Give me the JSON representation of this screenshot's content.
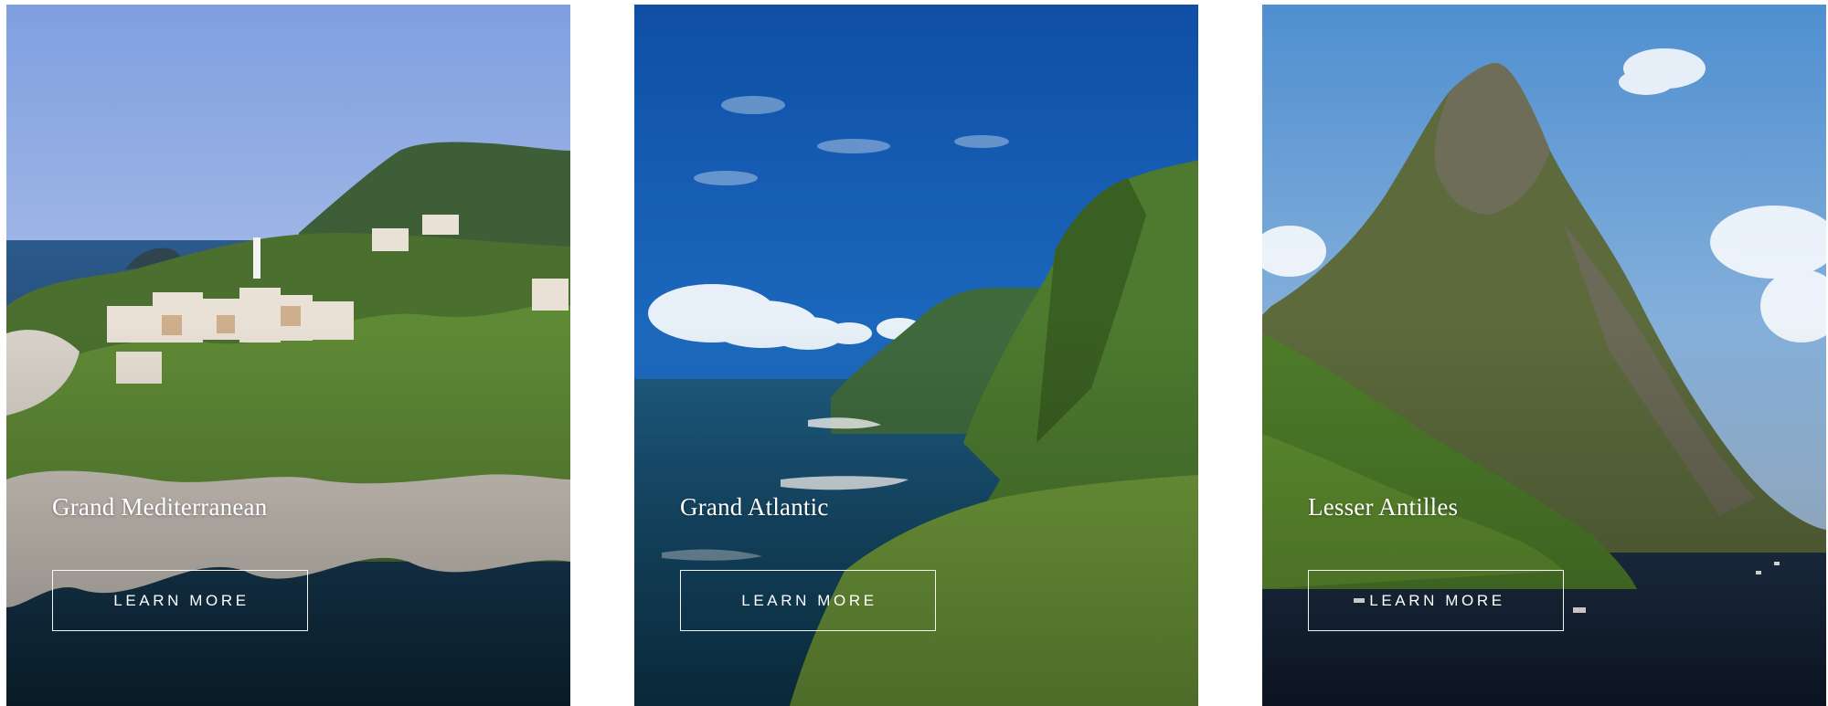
{
  "destinations": [
    {
      "title": "Grand Mediterranean",
      "cta_label": "LEARN MORE",
      "image_alt": "Cliffside Mediterranean village overlooking the sea"
    },
    {
      "title": "Grand Atlantic",
      "cta_label": "LEARN MORE",
      "image_alt": "Green Atlantic coastal cliffs above crashing waves"
    },
    {
      "title": "Lesser Antilles",
      "cta_label": "LEARN MORE",
      "image_alt": "Tall volcanic peak rising above a Caribbean bay"
    }
  ],
  "colors": {
    "text": "#ffffff",
    "button_border": "#ffffff",
    "page_background": "#ffffff"
  }
}
